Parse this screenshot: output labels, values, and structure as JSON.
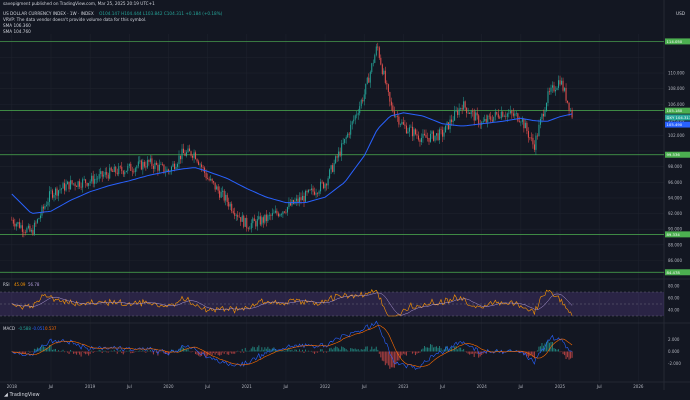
{
  "header": {
    "publisher": "savepigment published on TradingView.com, Mar 25, 2025 20:19 UTC+1",
    "symbol": "US DOLLAR CURRENCY INDEX · 1W · INDEX",
    "ohlc": "O104.147 H104.444 L103.842 C104.311 +0.184 (+0.18%)",
    "volume_note": "VRVP: The data vendor doesn't provide volume data for this symbol.",
    "sma1": "SMA   106.360",
    "sma2": "SMA   104.760",
    "currency": "USD"
  },
  "price_axis": {
    "ticks": [
      "114.000",
      "110.000",
      "108.000",
      "106.000",
      "104.000",
      "102.000",
      "98.000",
      "96.000",
      "94.000",
      "92.000",
      "90.000",
      "88.000",
      "86.000"
    ],
    "labels": [
      {
        "name": "level-114",
        "text": "114.050",
        "color": "#4caf50"
      },
      {
        "name": "level-105",
        "text": "105.180",
        "color": "#4caf50"
      },
      {
        "name": "dxy-price",
        "text": "DXY  104.311",
        "color": "#26a69a"
      },
      {
        "name": "sma-value",
        "text": "105.490",
        "color": "#2962ff"
      },
      {
        "name": "level-99",
        "text": "99.536",
        "color": "#4caf50"
      },
      {
        "name": "level-89",
        "text": "89.334",
        "color": "#4caf50"
      },
      {
        "name": "level-84",
        "text": "84.478",
        "color": "#4caf50"
      }
    ]
  },
  "rsi": {
    "label": "RSI",
    "v1": "45.09",
    "v2": "56.78",
    "ticks": [
      "80.00",
      "60.00",
      "40.00"
    ]
  },
  "macd": {
    "label": "MACD",
    "v1": "-0.588",
    "v2": "-0.051",
    "v3": "0.537",
    "ticks": [
      "2.000",
      "0.000",
      "-2.000"
    ]
  },
  "time_axis": [
    "2018",
    "Jul",
    "2019",
    "Jul",
    "2020",
    "Jul",
    "2021",
    "Jul",
    "2022",
    "Jul",
    "2023",
    "Jul",
    "2024",
    "Jul",
    "2025",
    "Jul",
    "2026"
  ],
  "brand": "TradingView",
  "chart_data": {
    "type": "line",
    "title": "US DOLLAR CURRENCY INDEX · 1W · INDEX",
    "x": [
      "2018-01",
      "2018-04",
      "2018-07",
      "2018-10",
      "2019-01",
      "2019-04",
      "2019-07",
      "2019-10",
      "2020-01",
      "2020-03",
      "2020-05",
      "2020-07",
      "2020-10",
      "2021-01",
      "2021-04",
      "2021-07",
      "2021-10",
      "2022-01",
      "2022-04",
      "2022-07",
      "2022-09",
      "2022-11",
      "2023-01",
      "2023-04",
      "2023-07",
      "2023-10",
      "2024-01",
      "2024-04",
      "2024-07",
      "2024-09",
      "2024-11",
      "2025-01",
      "2025-03"
    ],
    "series": [
      {
        "name": "DXY",
        "values": [
          91.2,
          89.5,
          94.6,
          95.8,
          96.2,
          97.2,
          97.8,
          98.5,
          97.4,
          99.6,
          99.8,
          96.5,
          93.6,
          90.5,
          91.3,
          92.7,
          94.2,
          95.9,
          101.2,
          107.3,
          113.5,
          105.8,
          103.2,
          101.6,
          102.2,
          106.0,
          103.5,
          105.0,
          104.3,
          100.6,
          106.8,
          109.2,
          104.3
        ]
      },
      {
        "name": "SMA",
        "values": [
          94.5,
          92.0,
          92.3,
          93.7,
          94.8,
          95.6,
          96.2,
          96.9,
          97.4,
          97.7,
          97.9,
          97.4,
          96.5,
          95.2,
          94.1,
          93.4,
          93.4,
          94.1,
          96.0,
          99.4,
          102.8,
          104.5,
          104.9,
          104.5,
          103.5,
          103.2,
          103.5,
          103.8,
          104.2,
          103.9,
          103.8,
          104.4,
          104.8
        ]
      }
    ],
    "ylim": [
      84,
      115
    ],
    "levels": [
      114.05,
      105.18,
      99.536,
      89.334,
      84.478
    ]
  }
}
